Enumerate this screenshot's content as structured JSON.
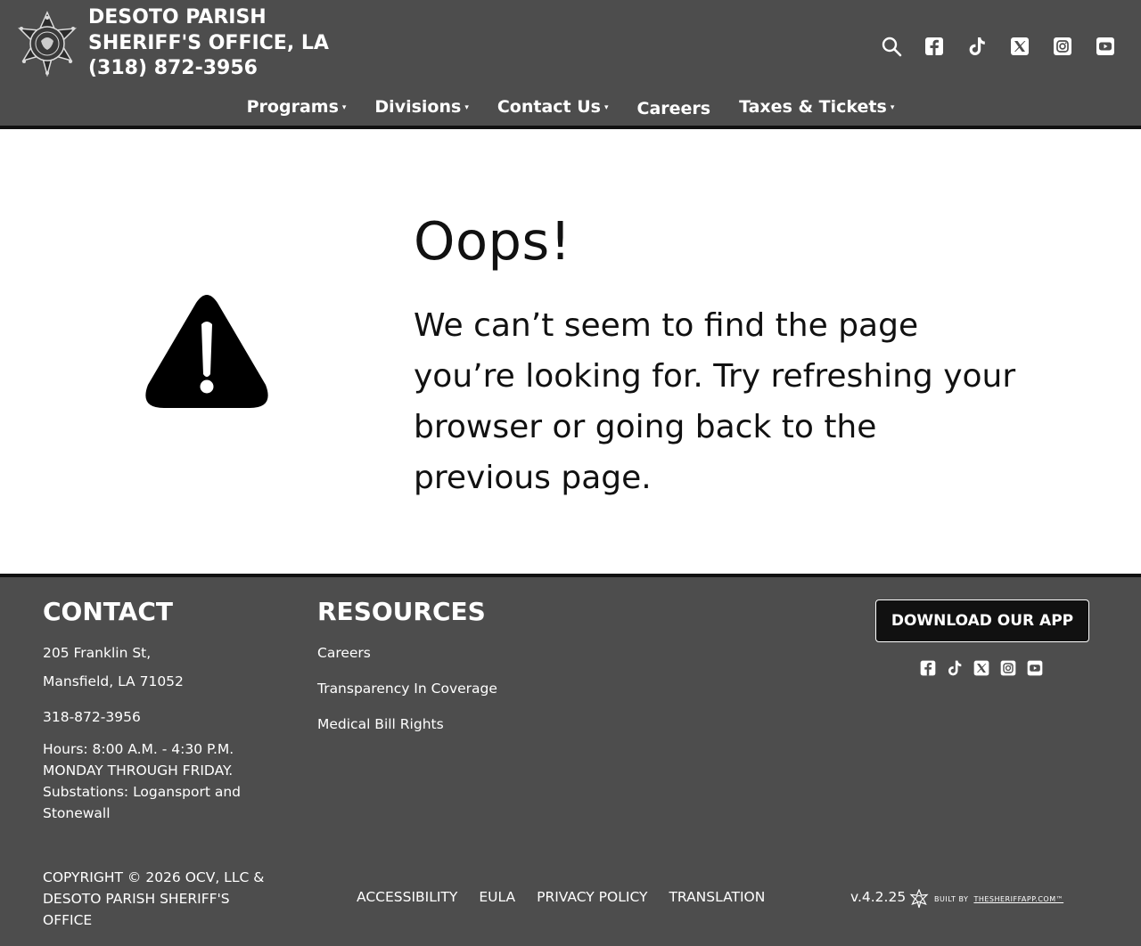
{
  "header": {
    "title_lines": [
      "DESOTO PARISH",
      "SHERIFF'S OFFICE, LA",
      "(318) 872-3956"
    ],
    "social_icons": [
      "search-icon",
      "facebook-icon",
      "tiktok-icon",
      "x-twitter-icon",
      "instagram-icon",
      "youtube-icon"
    ]
  },
  "nav": {
    "items": [
      {
        "label": "Programs",
        "has_dropdown": true
      },
      {
        "label": "Divisions",
        "has_dropdown": true
      },
      {
        "label": "Contact Us",
        "has_dropdown": true
      },
      {
        "label": "Careers",
        "has_dropdown": false
      },
      {
        "label": "Taxes & Tickets",
        "has_dropdown": true
      }
    ],
    "caret": "▾"
  },
  "error": {
    "heading": "Oops!",
    "message": "We can’t seem to find the page you’re looking for. Try refreshing your browser or going back to the previous page.",
    "icon": "warning-triangle-icon"
  },
  "footer": {
    "contact": {
      "heading": "CONTACT",
      "address_line1": "205 Franklin St,",
      "address_line2": "Mansfield, LA 71052",
      "phone": "318-872-3956",
      "hours": "Hours: 8:00 A.M. - 4:30 P.M. MONDAY THROUGH FRIDAY. Substations: Logansport and Stonewall"
    },
    "resources": {
      "heading": "RESOURCES",
      "links": [
        "Careers",
        "Transparency In Coverage",
        "Medical Bill Rights"
      ]
    },
    "app_button": "DOWNLOAD OUR APP",
    "social_icons": [
      "facebook-icon",
      "tiktok-icon",
      "x-twitter-icon",
      "instagram-icon",
      "youtube-icon"
    ],
    "copyright": "COPYRIGHT © 2026 OCV, LLC & DESOTO PARISH SHERIFF'S OFFICE",
    "legal_links": [
      "ACCESSIBILITY",
      "EULA",
      "PRIVACY POLICY",
      "TRANSLATION"
    ],
    "version": "v.4.2.25",
    "built_by_prefix": "BUILT BY",
    "built_by_link": "THESHERIFFAPP.COM™"
  },
  "colors": {
    "header_bg": "#4d4d4d",
    "footer_bg": "#4d4d4d",
    "divider": "#111111",
    "text_light": "#ffffff",
    "text_dark": "#111111"
  }
}
